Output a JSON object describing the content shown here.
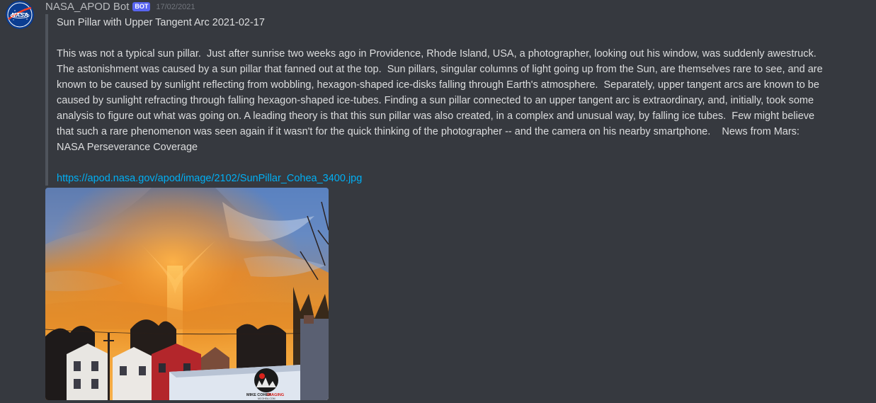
{
  "message": {
    "author": "NASA_APOD Bot",
    "bot_tag": "BOT",
    "timestamp": "17/02/2021",
    "avatar_icon": "nasa-logo-icon"
  },
  "embed": {
    "title": "Sun Pillar with Upper Tangent Arc 2021-02-17",
    "description": "This was not a typical sun pillar.  Just after sunrise two weeks ago in Providence, Rhode Island, USA, a photographer, looking out his window, was suddenly awestruck. The astonishment was caused by a sun pillar that fanned out at the top.  Sun pillars, singular columns of light going up from the Sun, are themselves rare to see, and are known to be caused by sunlight reflecting from wobbling, hexagon-shaped ice-disks falling through Earth's atmosphere.  Separately, upper tangent arcs are known to be caused by sunlight refracting through falling hexagon-shaped ice-tubes. Finding a sun pillar connected to an upper tangent arc is extraordinary, and, initially, took some analysis to figure out what was going on. A leading theory is that this sun pillar was also created, in a complex and unusual way, by falling ice tubes.  Few might believe that such a rare phenomenon was seen again if it wasn't for the quick thinking of the photographer -- and the camera on his nearby smartphone.    News from Mars: NASA Perseverance Coverage",
    "link": "https://apod.nasa.gov/apod/image/2102/SunPillar_Cohea_3400.jpg"
  },
  "image": {
    "watermark_name": "MIKE COHEA",
    "watermark_name_accent": "IMAGING",
    "watermark_site": "MCOHEA.COM"
  },
  "colors": {
    "background": "#36393f",
    "bot_tag": "#5865f2",
    "link": "#00aff4",
    "embed_border": "#4f545c"
  }
}
